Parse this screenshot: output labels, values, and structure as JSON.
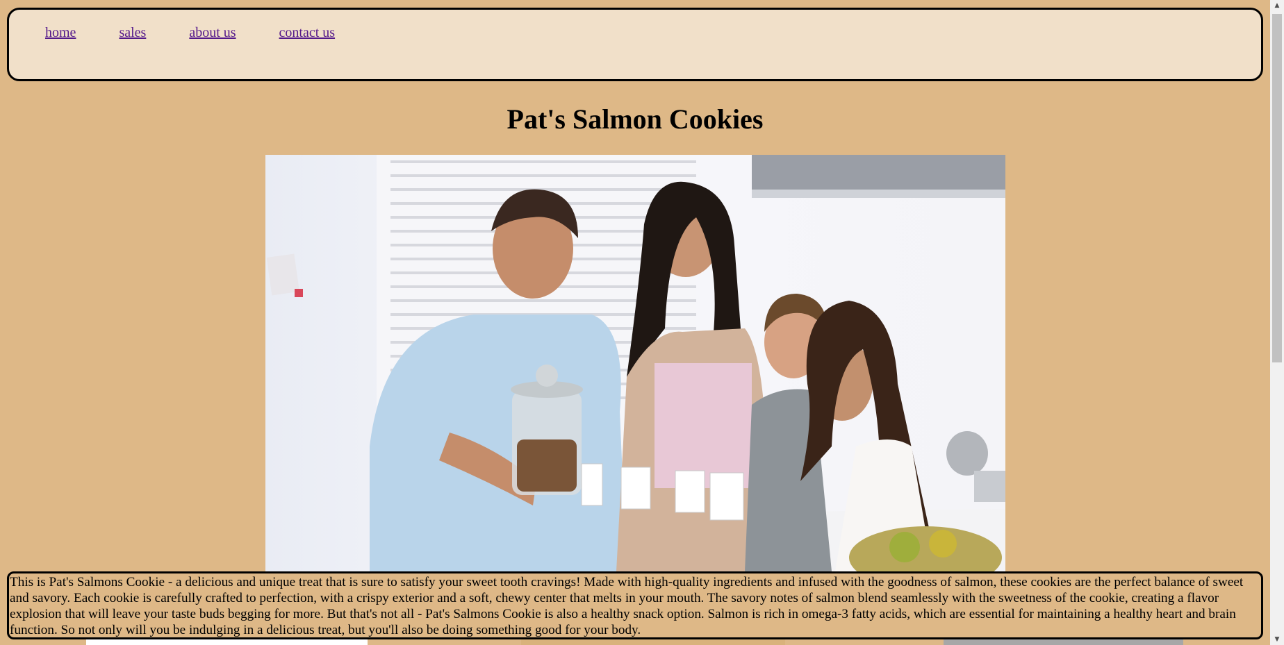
{
  "nav": {
    "items": [
      {
        "label": "home"
      },
      {
        "label": "sales"
      },
      {
        "label": "about us"
      },
      {
        "label": "contact us"
      }
    ]
  },
  "page": {
    "title": "Pat's Salmon Cookies"
  },
  "description": "This is Pat's Salmons Cookie - a delicious and unique treat that is sure to satisfy your sweet tooth cravings! Made with high-quality ingredients and infused with the goodness of salmon, these cookies are the perfect balance of sweet and savory. Each cookie is carefully crafted to perfection, with a crispy exterior and a soft, chewy center that melts in your mouth. The savory notes of salmon blend seamlessly with the sweetness of the cookie, creating a flavor explosion that will leave your taste buds begging for more. But that's not all - Pat's Salmons Cookie is also a healthy snack option. Salmon is rich in omega-3 fatty acids, which are essential for maintaining a healthy heart and brain function. So not only will you be indulging in a delicious treat, but you'll also be doing something good for your body.",
  "icons": {
    "scroll_up": "chevron-up-icon",
    "scroll_down": "chevron-down-icon"
  },
  "colors": {
    "page_background": "#deb887",
    "nav_background": "#f1e0c9",
    "link": "#551a8b"
  }
}
